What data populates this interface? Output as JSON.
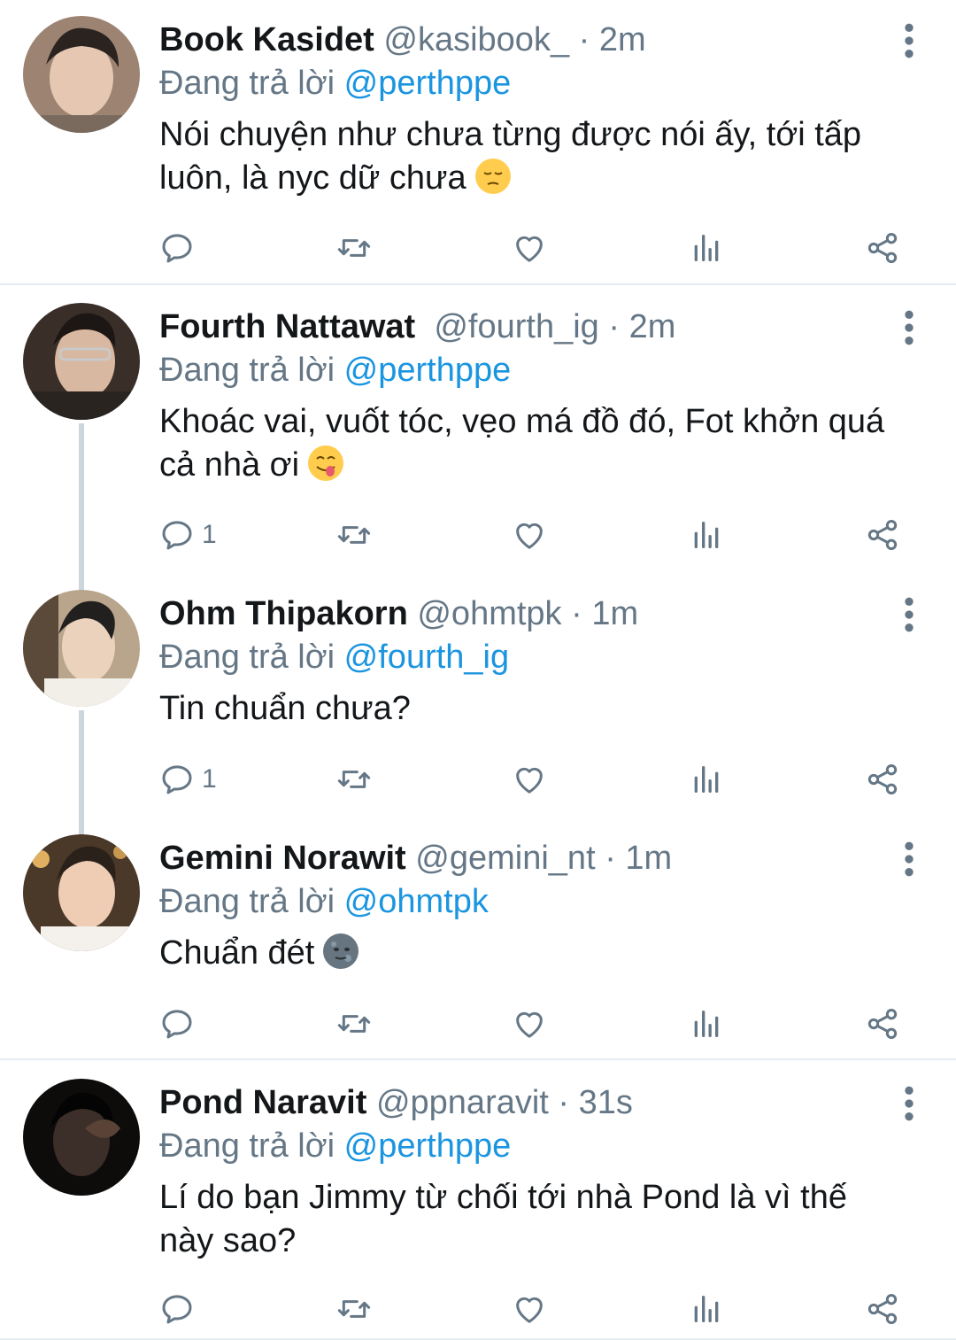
{
  "tweets": [
    {
      "name": "Book Kasidet",
      "handle": "@kasibook_",
      "sep": "·",
      "time": "2m",
      "replying_label": "Đang trả lời",
      "replying_to": "@perthppe",
      "text": "Nói chuyện như chưa từng được nói ấy, tới tấp luôn, là nyc dữ chưa",
      "emoji": "pensive-face",
      "reply_count": ""
    },
    {
      "name": "Fourth Nattawat",
      "handle": "@fourth_ig",
      "sep": "·",
      "time": "2m",
      "replying_label": "Đang trả lời",
      "replying_to": "@perthppe",
      "text": "Khoác vai, vuốt tóc, vẹo má đồ đó, Fot khởn quá cả nhà ơi",
      "emoji": "face-savoring-food",
      "reply_count": "1"
    },
    {
      "name": "Ohm Thipakorn",
      "handle": "@ohmtpk",
      "sep": "·",
      "time": "1m",
      "replying_label": "Đang trả lời",
      "replying_to": "@fourth_ig",
      "text": "Tin chuẩn chưa?",
      "emoji": "",
      "reply_count": "1"
    },
    {
      "name": "Gemini Norawit",
      "handle": "@gemini_nt",
      "sep": "·",
      "time": "1m",
      "replying_label": "Đang trả lời",
      "replying_to": "@ohmtpk",
      "text": "Chuẩn đét",
      "emoji": "new-moon-face",
      "reply_count": ""
    },
    {
      "name": "Pond Naravit",
      "handle": "@ppnaravit",
      "sep": "·",
      "time": "31s",
      "replying_label": "Đang trả lời",
      "replying_to": "@perthppe",
      "text": "Lí do bạn Jimmy từ chối tới nhà Pond là vì thế này sao?",
      "emoji": "",
      "reply_count": ""
    }
  ],
  "icons": {
    "reply": "reply-icon",
    "retweet": "retweet-icon",
    "like": "like-icon",
    "analytics": "analytics-icon",
    "share": "share-icon",
    "more": "more-icon"
  },
  "colors": {
    "mention": "#1b95e0",
    "secondary": "#657786",
    "thread_line": "#ccd6dd",
    "divider": "#e6ecf0"
  }
}
